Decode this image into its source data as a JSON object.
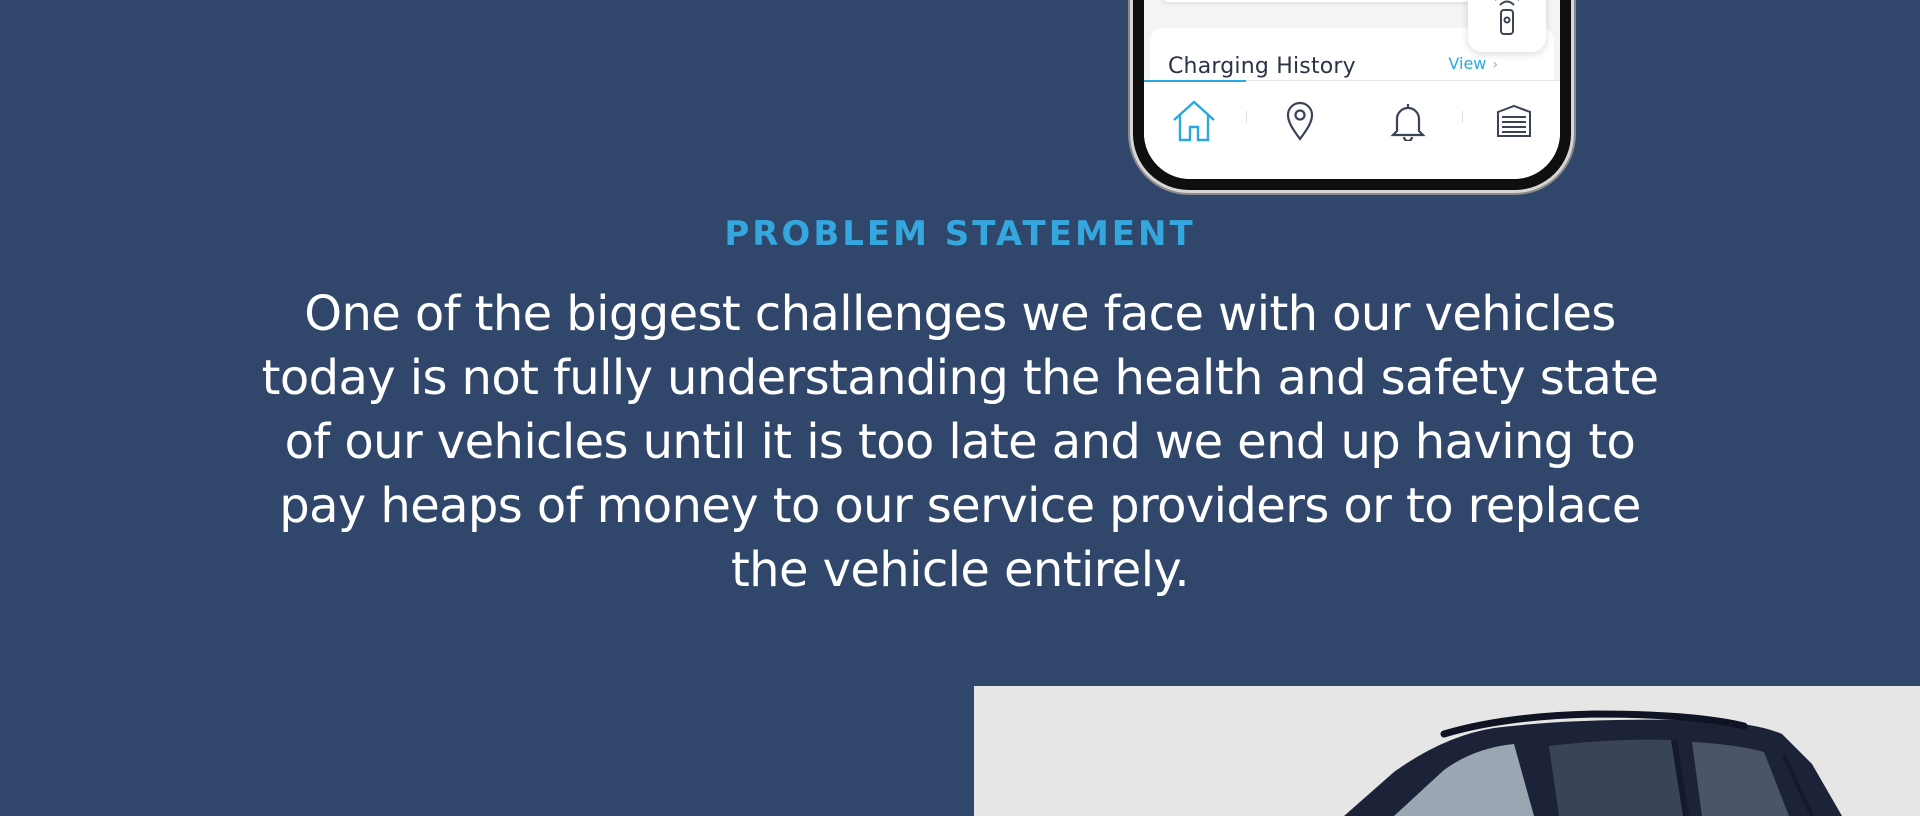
{
  "phone": {
    "history_title": "Charging History",
    "view_label": "View",
    "view_chevron": "›",
    "tabs": [
      {
        "icon": "home-icon",
        "active": true
      },
      {
        "icon": "location-pin-icon",
        "active": false
      },
      {
        "icon": "bell-icon",
        "active": false
      },
      {
        "icon": "garage-icon",
        "active": false
      }
    ],
    "remote_icon": "key-fob-icon"
  },
  "problem": {
    "eyebrow": "PROBLEM STATEMENT",
    "text": "One of the biggest challenges we face with our vehicles today is not fully understanding the health and safety state of our vehicles until it is too late and we end up having to pay heaps of money to our service providers or to replace the vehicle entirely."
  },
  "colors": {
    "background": "#31466b",
    "accent": "#35a7df",
    "text": "#ffffff",
    "car_panel": "#e6e6e6"
  }
}
